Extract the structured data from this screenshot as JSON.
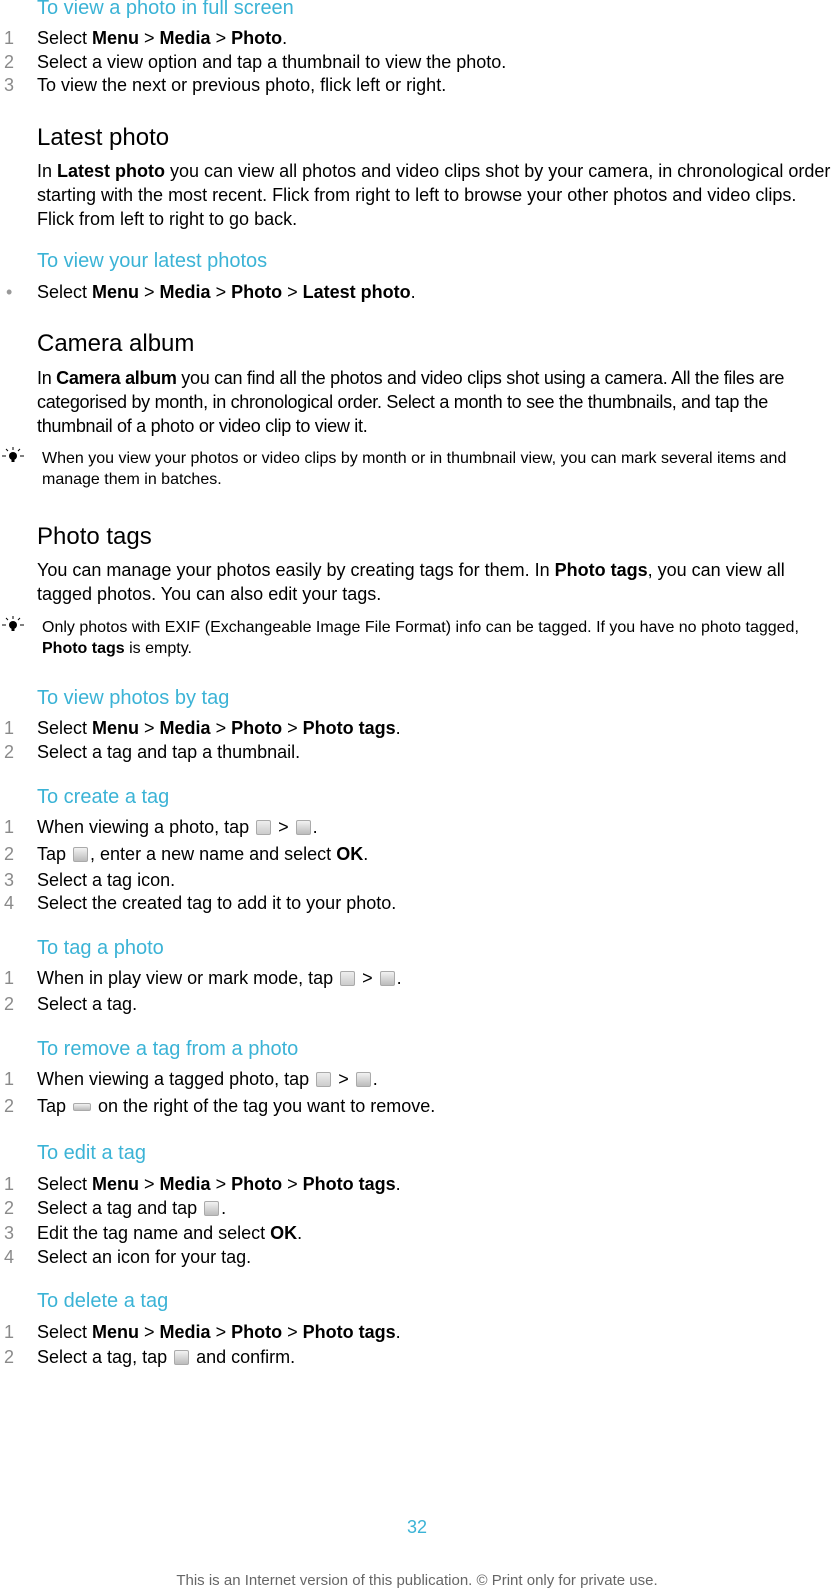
{
  "sections": {
    "view_full": {
      "heading": "To view a photo in full screen",
      "steps": [
        {
          "n": "1",
          "parts": [
            "Select ",
            "Menu",
            " > ",
            "Media",
            " > ",
            "Photo",
            "."
          ]
        },
        {
          "n": "2",
          "text": "Select a view option and tap a thumbnail to view the photo."
        },
        {
          "n": "3",
          "text": "To view the next or previous photo, flick left or right."
        }
      ]
    },
    "latest": {
      "title": "Latest photo",
      "para_pre": "In ",
      "para_bold": "Latest photo",
      "para_post": " you can view all photos and video clips shot by your camera, in chronological order starting with the most recent. Flick from right to left to browse your other photos and video clips. Flick from left to right to go back.",
      "sub_heading": "To view your latest photos",
      "bullet_parts": [
        "Select ",
        "Menu",
        " > ",
        "Media",
        " > ",
        "Photo",
        " > ",
        "Latest photo",
        "."
      ]
    },
    "camera_album": {
      "title": "Camera album",
      "para_pre": "In ",
      "para_bold": "Camera album",
      "para_post": " you can find all the photos and video clips shot using a camera. All the files are categorised by month, in chronological order. Select a month to see the thumbnails, and tap the thumbnail of a photo or video clip to view it.",
      "tip": "When you view your photos or video clips by month or in thumbnail view, you can mark several items and manage them in batches."
    },
    "photo_tags": {
      "title": "Photo tags",
      "para_pre": "You can manage your photos easily by creating tags for them. In ",
      "para_bold": "Photo tags",
      "para_post": ", you can view all tagged photos. You can also edit your tags.",
      "tip_pre": "Only photos with EXIF (Exchangeable Image File Format) info can be tagged. If you have no photo tagged, ",
      "tip_bold": "Photo tags",
      "tip_post": " is empty."
    },
    "view_by_tag": {
      "heading": "To view photos by tag",
      "s1": [
        "Select ",
        "Menu",
        " > ",
        "Media",
        " > ",
        "Photo",
        " > ",
        "Photo tags",
        "."
      ],
      "s2": "Select a tag and tap a thumbnail."
    },
    "create_tag": {
      "heading": "To create a tag",
      "s1_pre": "When viewing a photo, tap ",
      "s1_mid": " > ",
      "s1_post": ".",
      "s2_pre": "Tap ",
      "s2_post": ", enter a new name and select ",
      "s2_bold": "OK",
      "s2_end": ".",
      "s3": "Select a tag icon.",
      "s4": "Select the created tag to add it to your photo."
    },
    "tag_photo": {
      "heading": "To tag a photo",
      "s1_pre": "When in play view or mark mode, tap ",
      "s1_mid": " > ",
      "s1_post": ".",
      "s2": "Select a tag."
    },
    "remove_tag": {
      "heading": "To remove a tag from a photo",
      "s1_pre": "When viewing a tagged photo, tap ",
      "s1_mid": " > ",
      "s1_post": ".",
      "s2_pre": "Tap ",
      "s2_post": " on the right of the tag you want to remove."
    },
    "edit_tag": {
      "heading": "To edit a tag",
      "s1": [
        "Select ",
        "Menu",
        " > ",
        "Media",
        " > ",
        "Photo",
        " > ",
        "Photo tags",
        "."
      ],
      "s2_pre": "Select a tag and tap ",
      "s2_post": ".",
      "s3_pre": "Edit the tag name and select ",
      "s3_bold": "OK",
      "s3_post": ".",
      "s4": "Select an icon for your tag."
    },
    "delete_tag": {
      "heading": "To delete a tag",
      "s1": [
        "Select ",
        "Menu",
        " > ",
        "Media",
        " > ",
        "Photo",
        " > ",
        "Photo tags",
        "."
      ],
      "s2_pre": "Select a tag, tap ",
      "s2_post": " and confirm."
    }
  },
  "nums": [
    "1",
    "2",
    "3",
    "4"
  ],
  "bullet": "•",
  "footer": {
    "page_number": "32",
    "notice": "This is an Internet version of this publication. © Print only for private use."
  }
}
